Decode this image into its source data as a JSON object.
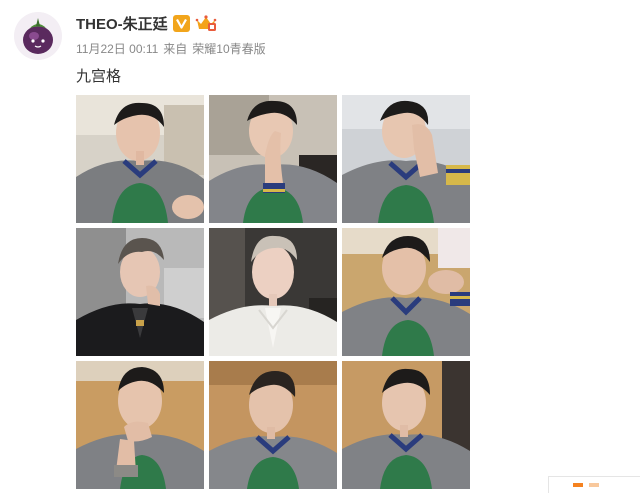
{
  "post": {
    "author": "THEO-朱正廷",
    "date": "11月22日 00:11",
    "source_prefix": "来自",
    "source_device": "荣耀10青春版",
    "text": "九宫格"
  },
  "icons": {
    "avatar": "mangosteen-avatar",
    "verified": "verified-v-badge",
    "member": "crown-member-badge"
  },
  "colors": {
    "verified_badge": "#f2a51b",
    "accent": "#f58220"
  },
  "photos": [
    {
      "name": "selfie-sweater-hand-ring"
    },
    {
      "name": "selfie-sweater-hand-nose"
    },
    {
      "name": "selfie-sweater-hand-face"
    },
    {
      "name": "portrait-black-suit"
    },
    {
      "name": "portrait-white-suit"
    },
    {
      "name": "selfie-sweater-sofa"
    },
    {
      "name": "selfie-sweater-hand-chin"
    },
    {
      "name": "selfie-sweater-sofa-close"
    },
    {
      "name": "selfie-sweater-sofa-smile"
    }
  ]
}
